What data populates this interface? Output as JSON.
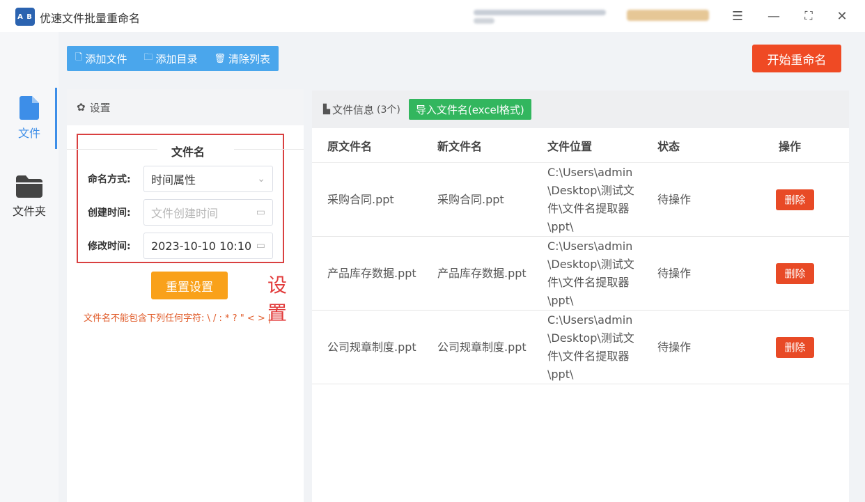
{
  "app": {
    "title": "优速文件批量重命名",
    "logo_text": "A B"
  },
  "nav": {
    "items": [
      {
        "label": "文件"
      },
      {
        "label": "文件夹"
      }
    ]
  },
  "toolbar": {
    "add_file": "添加文件",
    "add_dir": "添加目录",
    "clear_list": "清除列表",
    "start": "开始重命名"
  },
  "settings": {
    "header": "设置",
    "section_title": "文件名",
    "rows": [
      {
        "label": "命名方式:",
        "value": "时间属性",
        "placeholder": ""
      },
      {
        "label": "创建时间:",
        "value": "",
        "placeholder": "文件创建时间"
      },
      {
        "label": "修改时间:",
        "value": "2023-10-10 10:10",
        "placeholder": ""
      }
    ],
    "reset": "重置设置",
    "annotation": "设置",
    "warning": "文件名不能包含下列任何字符: \\ / : * ? \" < > |"
  },
  "files": {
    "header": "文件信息",
    "count": "(3个)",
    "import_button": "导入文件名(excel格式)",
    "columns": [
      "原文件名",
      "新文件名",
      "文件位置",
      "状态",
      "操作"
    ],
    "rows": [
      {
        "orig": "采购合同.ppt",
        "new": "采购合同.ppt",
        "loc": "C:\\Users\\admin\\Desktop\\测试文件\\文件名提取器\\ppt\\",
        "status": "待操作",
        "action": "删除"
      },
      {
        "orig": "产品库存数据.ppt",
        "new": "产品库存数据.ppt",
        "loc": "C:\\Users\\admin\\Desktop\\测试文件\\文件名提取器\\ppt\\",
        "status": "待操作",
        "action": "删除"
      },
      {
        "orig": "公司规章制度.ppt",
        "new": "公司规章制度.ppt",
        "loc": "C:\\Users\\admin\\Desktop\\测试文件\\文件名提取器\\ppt\\",
        "status": "待操作",
        "action": "删除"
      }
    ]
  },
  "colors": {
    "accent_blue": "#4aa6ec",
    "start_red": "#ef4a24",
    "import_green": "#32b65e",
    "reset_orange": "#f9a11a",
    "frame_red": "#d94040"
  }
}
